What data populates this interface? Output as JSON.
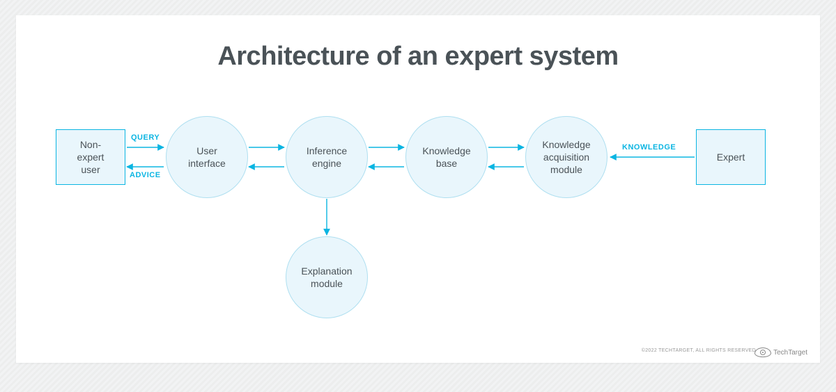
{
  "title": "Architecture of an expert system",
  "nodes": {
    "non_expert_user": "Non-\nexpert\nuser",
    "user_interface": "User\ninterface",
    "inference_engine": "Inference\nengine",
    "knowledge_base": "Knowledge\nbase",
    "knowledge_acquisition": "Knowledge\nacquisition\nmodule",
    "expert": "Expert",
    "explanation_module": "Explanation\nmodule"
  },
  "edge_labels": {
    "query": "QUERY",
    "advice": "ADVICE",
    "knowledge": "KNOWLEDGE"
  },
  "footer": {
    "copyright": "©2022 TECHTARGET, ALL RIGHTS RESERVED",
    "brand": "TechTarget"
  },
  "colors": {
    "accent": "#0bb5e2",
    "node_fill": "#e9f6fc",
    "text": "#4a5257"
  }
}
